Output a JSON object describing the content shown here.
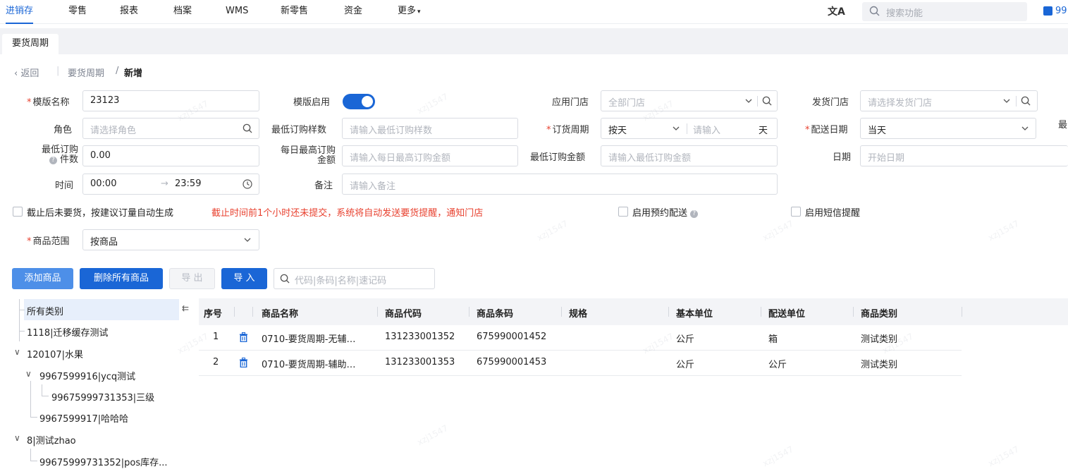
{
  "topnav": {
    "items": [
      "进销存",
      "零售",
      "报表",
      "档案",
      "WMS",
      "新零售",
      "资金",
      "更多"
    ],
    "search_placeholder": "搜索功能",
    "store_partial": "99"
  },
  "tabs": [
    "要货周期"
  ],
  "breadcrumb": {
    "back": "返回",
    "parent": "要货周期",
    "separator": "/",
    "current": "新增"
  },
  "form": {
    "template_name_label": "模版名称",
    "template_name_value": "23123",
    "template_enabled_label": "模版启用",
    "template_enabled": true,
    "apply_store_label": "应用门店",
    "apply_store_placeholder": "全部门店",
    "ship_store_label": "发货门店",
    "ship_store_placeholder": "请选择发货门店",
    "role_label": "角色",
    "role_placeholder": "请选择角色",
    "min_sample_label": "最低订购样数",
    "min_sample_placeholder": "请输入最低订购样数",
    "order_cycle_label": "订货周期",
    "order_cycle_value": "按天",
    "order_cycle_input_placeholder": "请输入",
    "order_cycle_unit": "天",
    "delivery_date_label": "配送日期",
    "delivery_date_value": "当天",
    "right_edge_partial": "最",
    "min_qty_label_l1": "最低订购",
    "min_qty_label_l2": "件数",
    "min_qty_value": "0.00",
    "daily_max_label_l1": "每日最高订购",
    "daily_max_label_l2": "金额",
    "daily_max_placeholder": "请输入每日最高订购金额",
    "min_amount_label": "最低订购金额",
    "min_amount_placeholder": "请输入最低订购金额",
    "date_label": "日期",
    "date_placeholder": "开始日期",
    "time_label": "时间",
    "time_start": "00:00",
    "time_arrow": "→",
    "time_end": "23:59",
    "remark_label": "备注",
    "remark_placeholder": "请输入备注",
    "auto_generate_label": "截止后未要货，按建议订量自动生成",
    "warning_text": "截止时间前1个小时还未提交，系统将自动发送要货提醒，通知门店",
    "reserve_delivery_label": "启用预约配送",
    "sms_reminder_label": "启用短信提醒",
    "product_scope_label": "商品范围",
    "product_scope_value": "按商品"
  },
  "toolbar": {
    "add_label": "添加商品",
    "delete_all_label": "删除所有商品",
    "export_label": "导 出",
    "import_label": "导 入",
    "search_placeholder": "代码|条码|名称|速记码"
  },
  "tree": [
    "所有类别",
    "1118|迁移缓存测试",
    "120107|水果",
    "9967599916|ycq测试",
    "99675999731353|三级",
    "9967599917|哈哈哈",
    "8|测试zhao",
    "99675999731352|pos库存..."
  ],
  "grid": {
    "columns": [
      "序号",
      "商品名称",
      "商品代码",
      "商品条码",
      "规格",
      "基本单位",
      "配送单位",
      "商品类别"
    ],
    "rows": [
      {
        "idx": "1",
        "name": "0710-要货周期-无辅…",
        "code": "131233001352",
        "barcode": "675990001452",
        "spec": "",
        "base_unit": "公斤",
        "delivery_unit": "箱",
        "category": "测试类别"
      },
      {
        "idx": "2",
        "name": "0710-要货周期-辅助…",
        "code": "131233001353",
        "barcode": "675990001453",
        "spec": "",
        "base_unit": "公斤",
        "delivery_unit": "公斤",
        "category": "测试类别"
      }
    ]
  },
  "watermark": "xzj1547",
  "colors": {
    "primary": "#1a66d6",
    "primary_light": "#4d8fe8",
    "required": "#e8412f",
    "warning": "#e8412f"
  }
}
